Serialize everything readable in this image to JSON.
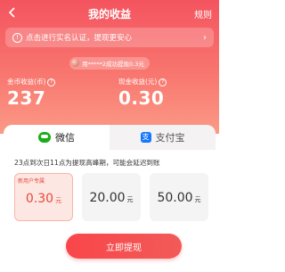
{
  "header": {
    "title": "我的收益",
    "rules_label": "规则",
    "back_icon": "chevron-left-icon"
  },
  "notice": {
    "icon_char": "!",
    "text": "点击进行实名认证，提现更安心",
    "chevron": "›"
  },
  "ticker": {
    "text": "用*****2成功提现0.3元"
  },
  "stats": {
    "coins_label": "金币收益(币)",
    "coins_value": "237",
    "cash_label": "现金收益(元)",
    "cash_value": "0.30",
    "help_icon": "?"
  },
  "tabs": {
    "wechat_label": "微信",
    "alipay_label": "支付宝",
    "alipay_icon_char": "支"
  },
  "hint": "23点到次日11点为提现高峰期，可能会延迟到账",
  "options": [
    {
      "tag": "新用户专属",
      "amount": "0.30",
      "unit": "元"
    },
    {
      "tag": "",
      "amount": "20.00",
      "unit": "元"
    },
    {
      "tag": "",
      "amount": "50.00",
      "unit": "元"
    }
  ],
  "withdraw_button": "立即提现",
  "colors": {
    "accent": "#f4545f",
    "wechat": "#1aad19",
    "alipay": "#1677ff",
    "selected_text": "#e8483b"
  }
}
